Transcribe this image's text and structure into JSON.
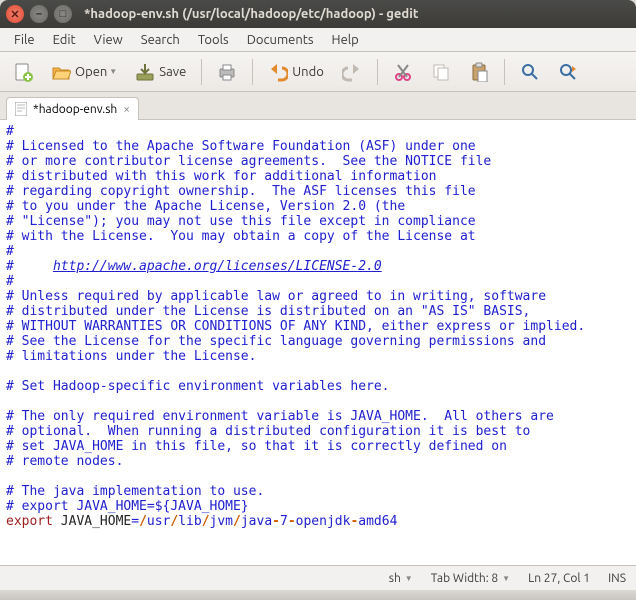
{
  "title": "*hadoop-env.sh (/usr/local/hadoop/etc/hadoop) - gedit",
  "menu": [
    "File",
    "Edit",
    "View",
    "Search",
    "Tools",
    "Documents",
    "Help"
  ],
  "toolbar": {
    "open": "Open",
    "save": "Save",
    "undo": "Undo"
  },
  "tab": {
    "name": "*hadoop-env.sh"
  },
  "code": {
    "license": [
      "#",
      "# Licensed to the Apache Software Foundation (ASF) under one",
      "# or more contributor license agreements.  See the NOTICE file",
      "# distributed with this work for additional information",
      "# regarding copyright ownership.  The ASF licenses this file",
      "# to you under the Apache License, Version 2.0 (the",
      "# \"License\"); you may not use this file except in compliance",
      "# with the License.  You may obtain a copy of the License at",
      "#"
    ],
    "url_prefix": "#     ",
    "url": "http://www.apache.org/licenses/LICENSE-2.0",
    "license2": [
      "#",
      "# Unless required by applicable law or agreed to in writing, software",
      "# distributed under the License is distributed on an \"AS IS\" BASIS,",
      "# WITHOUT WARRANTIES OR CONDITIONS OF ANY KIND, either express or implied.",
      "# See the License for the specific language governing permissions and",
      "# limitations under the License.",
      "",
      "# Set Hadoop-specific environment variables here.",
      "",
      "# The only required environment variable is JAVA_HOME.  All others are",
      "# optional.  When running a distributed configuration it is best to",
      "# set JAVA_HOME in this file, so that it is correctly defined on",
      "# remote nodes.",
      "",
      "# The java implementation to use.",
      "# export JAVA_HOME=${JAVA_HOME}"
    ],
    "export_kw": "export",
    "export_var": " JAVA_HOME",
    "export_eq": "=",
    "export_parts": [
      "/",
      "usr",
      "/",
      "lib",
      "/",
      "jvm",
      "/",
      "java",
      "-",
      "7",
      "-",
      "openjdk",
      "-",
      "amd64"
    ]
  },
  "status": {
    "lang": "sh",
    "tabwidth": "Tab Width: 8",
    "pos": "Ln 27, Col 1",
    "ins": "INS"
  }
}
